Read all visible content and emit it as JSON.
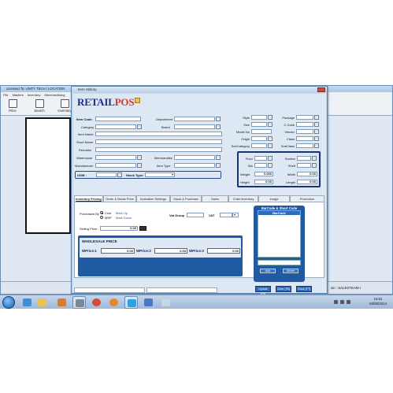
{
  "bg_app": {
    "title": "Licensed To: UNITY TECH / LOCATION",
    "menu": [
      "File",
      "Masters",
      "Inventory",
      "Merchandising"
    ],
    "toolbar": [
      "Price",
      "Search",
      "Inventory"
    ],
    "status_text": "ion : SALESTEAM I"
  },
  "dialog": {
    "title": "Item History",
    "logo": {
      "main": "RETAIL",
      "accent": "POS"
    },
    "labels": {
      "item_code": "Item Code:",
      "category": "Category",
      "item_name": "Item Name",
      "short_name": "Short Name",
      "remarks": "Remarks",
      "warehouse": "Warehouse",
      "manufacturer": "Manufacturer",
      "uom": "UOM :",
      "stock_type": "Stock Type:",
      "department": "Department",
      "brand": "Brand",
      "merchandise": "Merchandise",
      "item_type": "Item Type",
      "style": "Style",
      "size": "Size",
      "model_no": "Model No",
      "origin": "Origin",
      "subcategory": "SubCategory",
      "package": "Package",
      "c_code": "C Code",
      "vendor": "Vendor",
      "class": "Class",
      "subclass": "SubClass",
      "floor": "Floor",
      "bin": "Bin",
      "section": "Section",
      "shelf": "Shelf",
      "weight": "Weight",
      "height": "Height",
      "width": "Width",
      "length": "Length"
    },
    "values": {
      "weight": "0.000",
      "height": "0.00",
      "width": "0.00",
      "length": "0.00"
    },
    "tabs": [
      "Inventory Pricing",
      "Order & Break Price",
      "Activation Settings",
      "Stock & Purchase",
      "Sales",
      "Child Inventory",
      "Image",
      "Promotion"
    ],
    "pricing": {
      "purchased_by": "Purchased By",
      "cost": "Cost",
      "mrp": "MRP",
      "mark_up": "Mark Up",
      "mark_down": "Mark Down",
      "vat_group": "Vat Group",
      "vat": "VAT",
      "selling_price_label": "Selling Price :",
      "selling_price": "0.00"
    },
    "wholesale": {
      "title": "WHOLESALE PRICE",
      "labels": [
        "WPrice:1",
        "WPrice:2",
        "WPrice:3"
      ],
      "values": [
        "0.00",
        "0.00",
        "0.00"
      ]
    },
    "barcode": {
      "title": "BarCode & Short Code",
      "column": "BarCode",
      "add": "Add",
      "delete": "Delete"
    },
    "footer": {
      "buttons": [
        "Update (F5)",
        "Clear (F6)",
        "Close (F7)"
      ]
    }
  },
  "taskbar": {
    "clock_time": "16:51",
    "clock_date": "03/09/2014"
  },
  "colors": {
    "accent_blue": "#1f5aa3",
    "logo_blue": "#1b2f8a",
    "logo_red": "#d43a2a"
  }
}
